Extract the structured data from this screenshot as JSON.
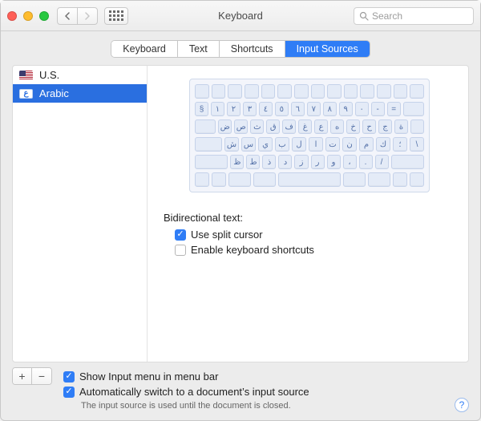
{
  "window": {
    "title": "Keyboard"
  },
  "search": {
    "placeholder": "Search"
  },
  "tabs": [
    {
      "label": "Keyboard"
    },
    {
      "label": "Text"
    },
    {
      "label": "Shortcuts"
    },
    {
      "label": "Input Sources"
    }
  ],
  "sources": [
    {
      "label": "U.S."
    },
    {
      "label": "Arabic"
    }
  ],
  "keyboard_rows": [
    [
      "§",
      "١",
      "٢",
      "٣",
      "٤",
      "٥",
      "٦",
      "٧",
      "٨",
      "٩",
      "٠",
      "-",
      "="
    ],
    [
      "ض",
      "ص",
      "ث",
      "ق",
      "ف",
      "غ",
      "ع",
      "ه",
      "خ",
      "ح",
      "ج",
      "ة"
    ],
    [
      "ش",
      "س",
      "ي",
      "ب",
      "ل",
      "ا",
      "ت",
      "ن",
      "م",
      "ك",
      "؛",
      "\\"
    ],
    [
      "ظ",
      "ط",
      "ذ",
      "د",
      "ز",
      "ر",
      "و",
      "،",
      ".",
      "/"
    ]
  ],
  "bidirectional": {
    "heading": "Bidirectional text:",
    "split_cursor": "Use split cursor",
    "kb_shortcuts": "Enable keyboard shortcuts"
  },
  "footer": {
    "show_menu": "Show Input menu in menu bar",
    "auto_switch": "Automatically switch to a document’s input source",
    "note": "The input source is used until the document is closed."
  }
}
